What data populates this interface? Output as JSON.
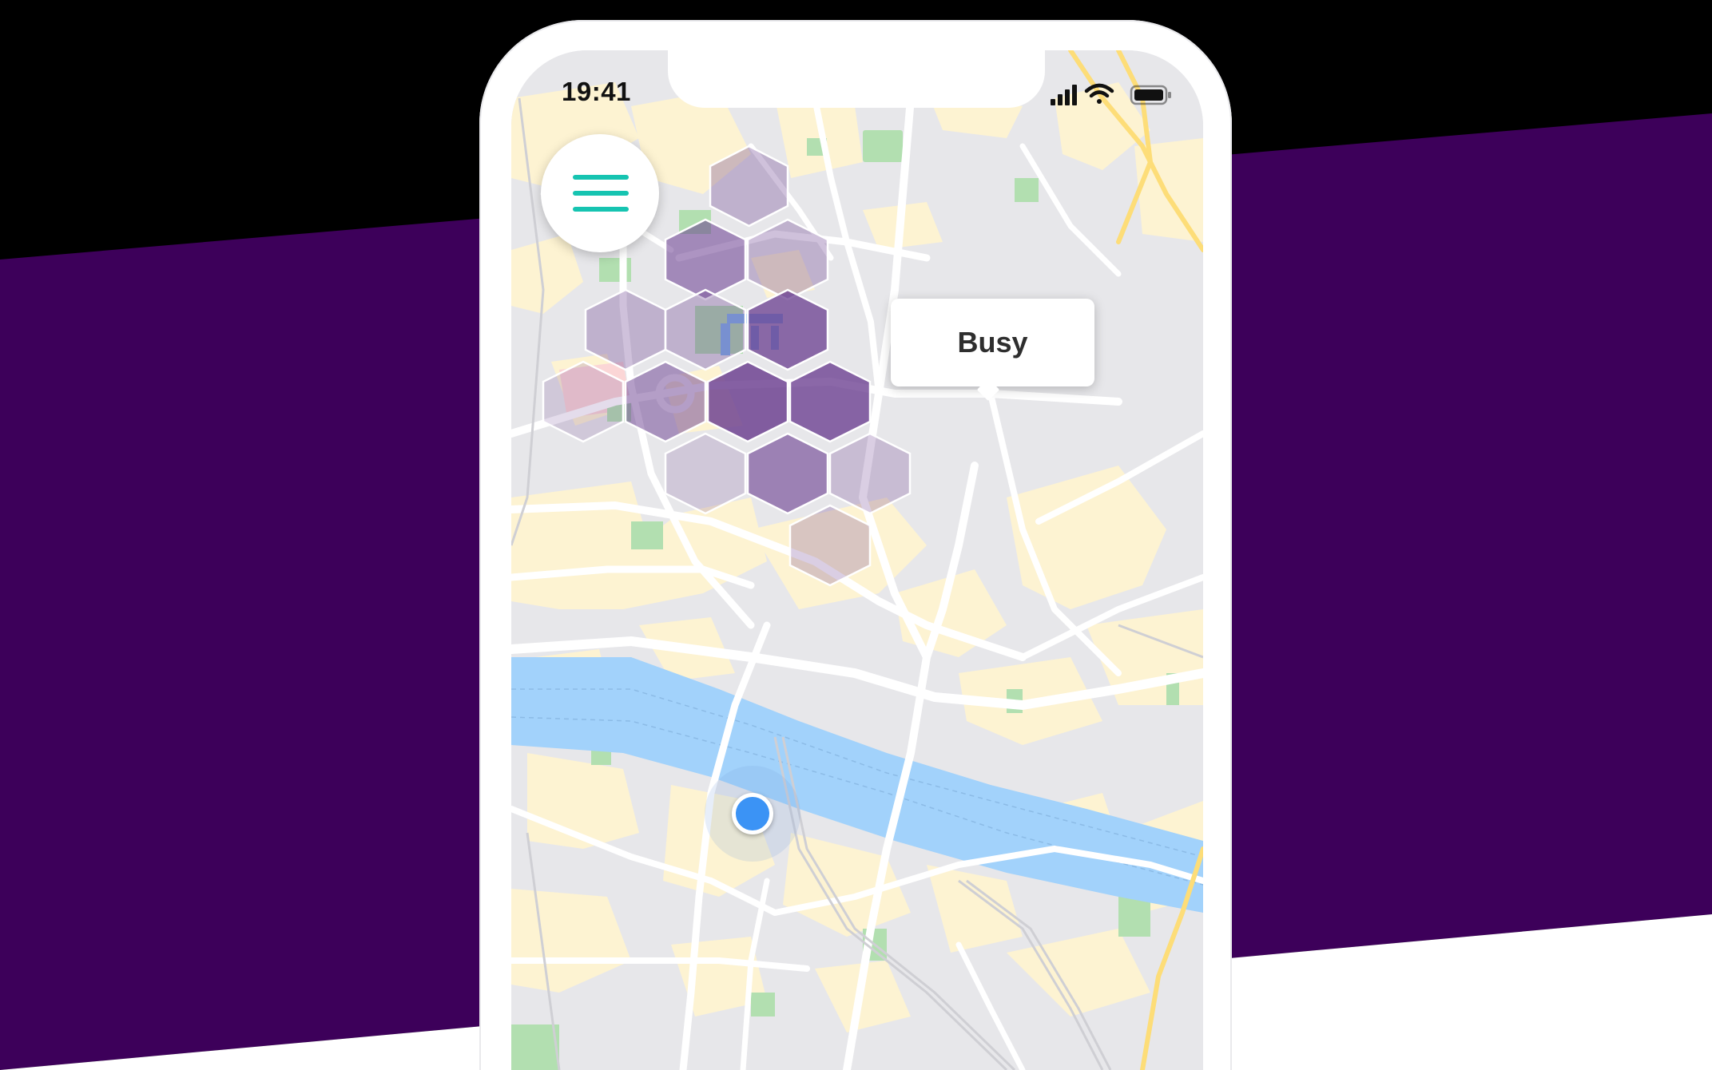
{
  "status_bar": {
    "time": "19:41"
  },
  "menu_button": {
    "icon": "hamburger-menu-icon",
    "color": "#16c4b1"
  },
  "busyness_overlay": {
    "tooltip_label": "Busy",
    "hex_color": "#6a3d8f"
  },
  "user_location": {
    "icon": "location-dot-icon",
    "color": "#3b93f5"
  },
  "colors": {
    "brand_purple": "#3d005a",
    "map_background": "#e7e7ea",
    "river": "#a2d2fb",
    "buildings": "#fdf3d2",
    "parks": "#b2dfb0",
    "major_roads": "#fddd78"
  }
}
